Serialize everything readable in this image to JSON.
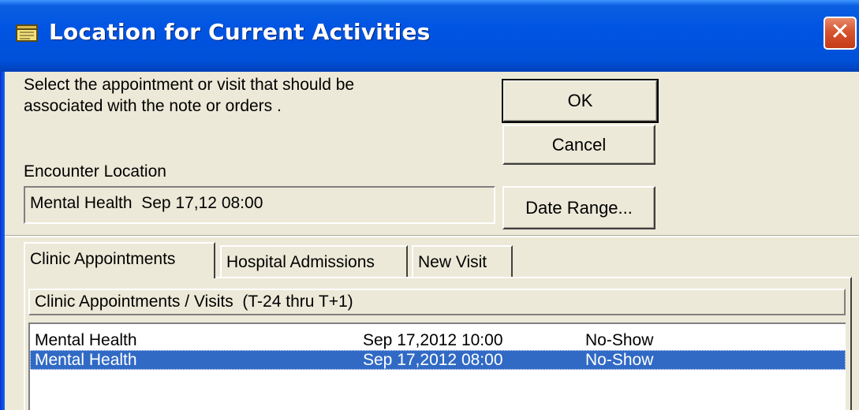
{
  "window": {
    "title": "Location for Current Activities",
    "icon": "notepad-icon",
    "close_glyph": "✕"
  },
  "instructions": "Select the appointment or visit that should be\nassociated with the note or orders .",
  "buttons": {
    "ok": "OK",
    "cancel": "Cancel",
    "date_range": "Date Range..."
  },
  "encounter": {
    "label": "Encounter Location",
    "value": "Mental Health  Sep 17,12 08:00"
  },
  "tabs": [
    {
      "label": "Clinic Appointments",
      "active": true
    },
    {
      "label": "Hospital Admissions",
      "active": false
    },
    {
      "label": "New Visit",
      "active": false
    }
  ],
  "list": {
    "header": "Clinic Appointments / Visits  (T-24 thru T+1)",
    "rows": [
      {
        "location": "Mental Health",
        "datetime": "Sep 17,2012 10:00",
        "status": "No-Show",
        "selected": false
      },
      {
        "location": "Mental Health",
        "datetime": "Sep 17,2012 08:00",
        "status": "No-Show",
        "selected": true
      }
    ]
  },
  "colors": {
    "titlebar": "#0054e3",
    "selection": "#316ac5",
    "face": "#ece9d8",
    "close": "#d7532f"
  }
}
